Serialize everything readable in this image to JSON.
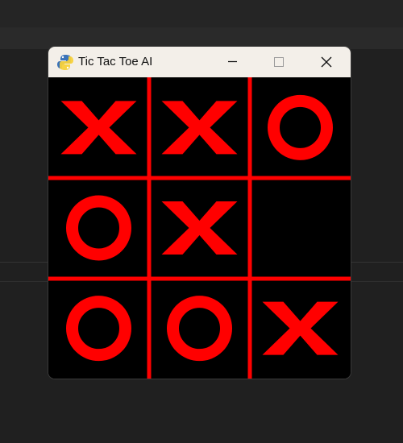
{
  "window": {
    "title": "Tic Tac Toe AI",
    "app_icon": "pygame-snake-icon",
    "controls": [
      "minimize-icon",
      "maximize-icon",
      "close-icon"
    ]
  },
  "game": {
    "board": [
      [
        "X",
        "X",
        "O"
      ],
      [
        "O",
        "X",
        ""
      ],
      [
        "O",
        "O",
        "X"
      ]
    ],
    "colors": {
      "background": "#000000",
      "grid": "#ff0000",
      "marks": "#ff0000"
    }
  }
}
